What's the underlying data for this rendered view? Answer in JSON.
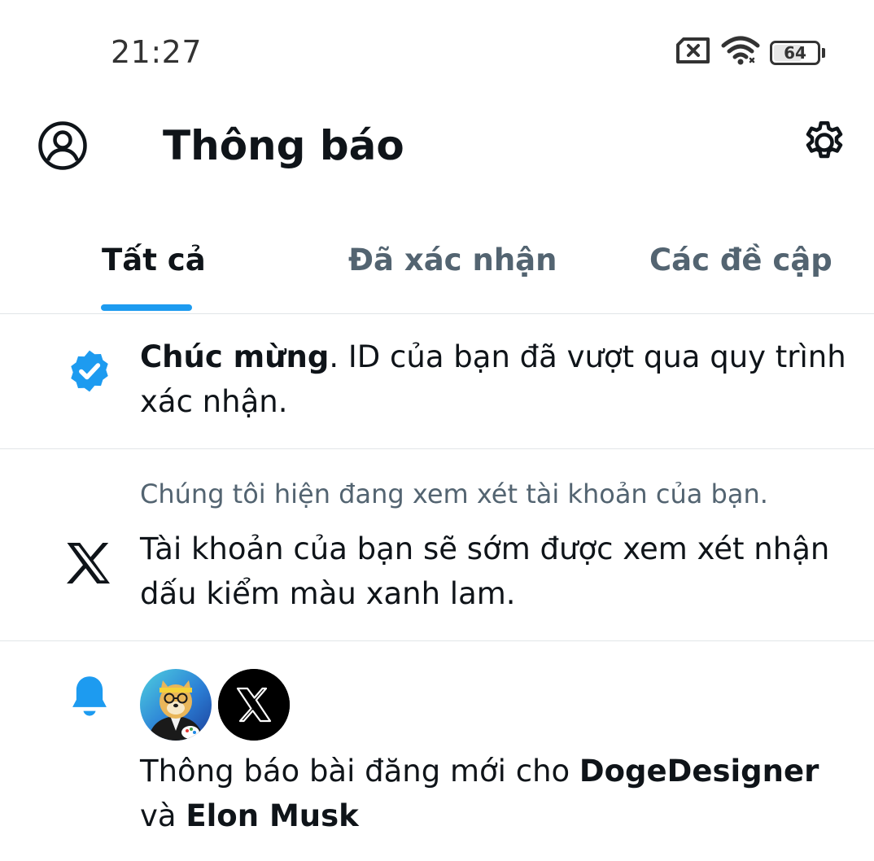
{
  "status_bar": {
    "time": "21:27",
    "battery_level": "64",
    "icons": [
      "sim-error-icon",
      "wifi-icon",
      "battery-icon"
    ]
  },
  "header": {
    "title": "Thông báo",
    "profile_icon": "profile-icon",
    "settings_icon": "gear-icon"
  },
  "tabs": [
    {
      "label": "Tất cả",
      "active": true
    },
    {
      "label": "Đã xác nhận",
      "active": false
    },
    {
      "label": "Các đề cập",
      "active": false
    }
  ],
  "notifications": [
    {
      "icon": "verified-badge-icon",
      "bold_text": "Chúc mừng",
      "text": ".  ID của bạn đã vượt qua quy trình xác nhận."
    },
    {
      "icon": "x-logo-icon",
      "subtitle": "Chúng tôi hiện đang xem xét tài khoản của bạn.",
      "text": "Tài khoản của bạn sẽ sớm được xem xét nhận dấu kiểm màu xanh lam."
    },
    {
      "icon": "bell-icon",
      "avatars": [
        "dogedesigner-avatar",
        "x-logo-avatar"
      ],
      "text_prefix": "Thông báo bài đăng mới cho ",
      "user1": "DogeDesigner",
      "text_mid": " và ",
      "user2": "Elon Musk"
    }
  ],
  "colors": {
    "accent": "#1d9bf0",
    "text_primary": "#0f1419",
    "text_secondary": "#536471",
    "divider": "#e1e5e8"
  }
}
